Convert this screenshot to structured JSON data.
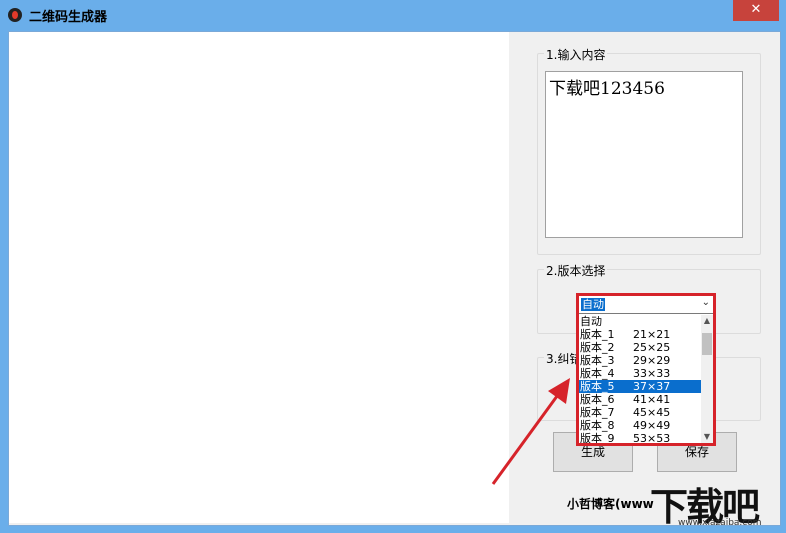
{
  "window": {
    "title": "二维码生成器",
    "close_label": "✕"
  },
  "groups": {
    "input_label": "1.输入内容",
    "version_label": "2.版本选择",
    "correction_label": "3.纠错"
  },
  "content_text": "下载吧123456",
  "version_select": {
    "selected": "自动",
    "options": [
      {
        "name": "自动",
        "size": ""
      },
      {
        "name": "版本_1",
        "size": "21×21"
      },
      {
        "name": "版本_2",
        "size": "25×25"
      },
      {
        "name": "版本_3",
        "size": "29×29"
      },
      {
        "name": "版本_4",
        "size": "33×33"
      },
      {
        "name": "版本_5",
        "size": "37×37",
        "highlighted": true
      },
      {
        "name": "版本_6",
        "size": "41×41"
      },
      {
        "name": "版本_7",
        "size": "45×45"
      },
      {
        "name": "版本_8",
        "size": "49×49"
      },
      {
        "name": "版本_9",
        "size": "53×53"
      }
    ]
  },
  "buttons": {
    "generate": "生成",
    "save": "保存"
  },
  "footer": "小哲博客(www",
  "watermark": {
    "text": "下载吧",
    "url": "www.xiazaiba.com"
  },
  "colors": {
    "highlight": "#0a6ecd",
    "annotation": "#d6232a"
  }
}
